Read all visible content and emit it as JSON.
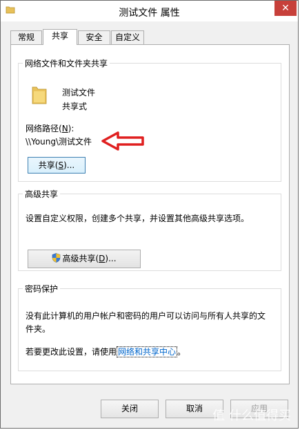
{
  "window": {
    "title": "测试文件 属性",
    "close_label": "✕"
  },
  "tabs": [
    {
      "label": "常规"
    },
    {
      "label": "共享"
    },
    {
      "label": "安全"
    },
    {
      "label": "自定义"
    }
  ],
  "network_sharing": {
    "legend": "网络文件和文件夹共享",
    "folder_name": "测试文件",
    "share_state": "共享式",
    "path_label_prefix": "网络路径(",
    "path_label_key": "N",
    "path_label_suffix": "):",
    "path_value": "\\\\Young\\测试文件",
    "share_button_prefix": "共享(",
    "share_button_key": "S",
    "share_button_suffix": ")...",
    "arrow_color": "#e02020"
  },
  "advanced_sharing": {
    "legend": "高级共享",
    "description": "设置自定义权限，创建多个共享，并设置其他高级共享选项。",
    "button_prefix": "高级共享(",
    "button_key": "D",
    "button_suffix": ")..."
  },
  "password_protection": {
    "legend": "密码保护",
    "description_line1": "没有此计算机的用户帐户和密码的用户可以访问与所有人共享的文",
    "description_line2": "件夹。",
    "change_prefix": "若要更改此设置，请使用",
    "change_link": "网络和共享中心",
    "change_suffix": "。"
  },
  "footer": {
    "close_button": "关闭",
    "cancel_button": "取消",
    "apply_button": "应用"
  },
  "watermark": "值 什么值得买"
}
